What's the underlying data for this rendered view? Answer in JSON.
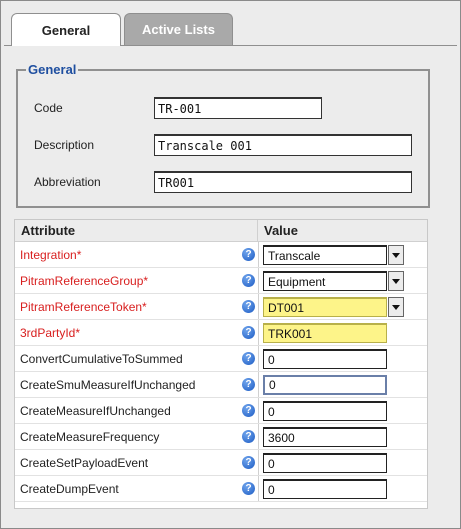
{
  "tabs": [
    {
      "label": "General"
    },
    {
      "label": "Active Lists"
    }
  ],
  "general": {
    "legend": "General",
    "fields": [
      {
        "label": "Code",
        "value": "TR-001"
      },
      {
        "label": "Description",
        "value": "Transcale 001"
      },
      {
        "label": "Abbreviation",
        "value": "TR001"
      }
    ]
  },
  "grid": {
    "headers": {
      "attribute": "Attribute",
      "value": "Value"
    },
    "help_glyph": "?",
    "rows": [
      {
        "name": "Integration*",
        "value": "Transcale"
      },
      {
        "name": "PitramReferenceGroup*",
        "value": "Equipment"
      },
      {
        "name": "PitramReferenceToken*",
        "value": "DT001"
      },
      {
        "name": "3rdPartyId*",
        "value": "TRK001"
      },
      {
        "name": "ConvertCumulativeToSummed",
        "value": "0"
      },
      {
        "name": "CreateSmuMeasureIfUnchanged",
        "value": "0"
      },
      {
        "name": "CreateMeasureIfUnchanged",
        "value": "0"
      },
      {
        "name": "CreateMeasureFrequency",
        "value": "3600"
      },
      {
        "name": "CreateSetPayloadEvent",
        "value": "0"
      },
      {
        "name": "CreateDumpEvent",
        "value": "0"
      }
    ]
  },
  "colors": {
    "required": "#d81e1e",
    "legend": "#1f4fa0",
    "highlight": "#fdf489",
    "help": "#1d5cc4"
  }
}
